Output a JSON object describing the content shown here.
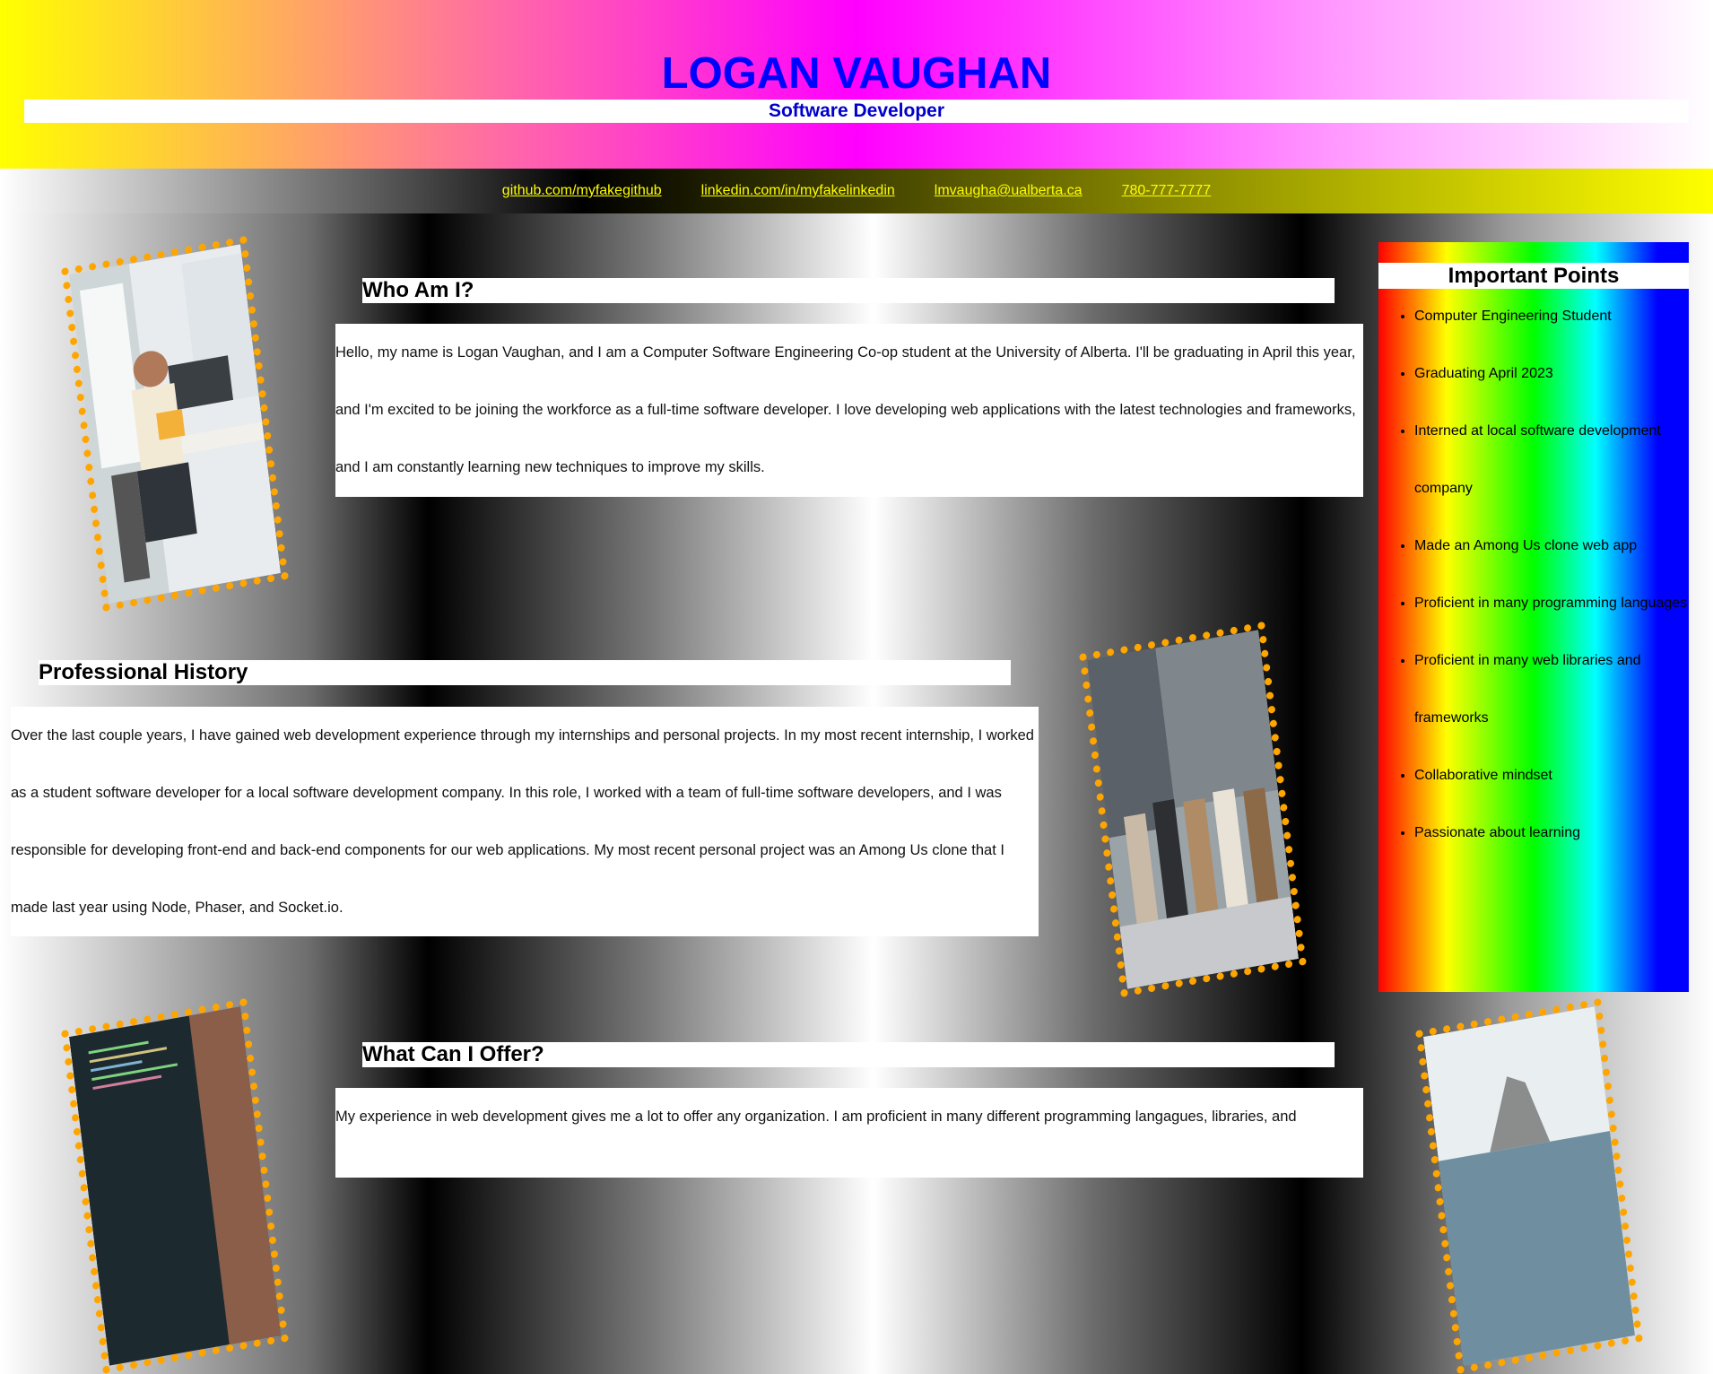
{
  "header": {
    "name": "LOGAN VAUGHAN",
    "title": "Software Developer"
  },
  "contact": {
    "links": [
      "github.com/myfakegithub",
      "linkedin.com/in/myfakelinkedin",
      "lmvaugha@ualberta.ca",
      "780-777-7777"
    ]
  },
  "sections": {
    "who": {
      "heading": "Who Am I?",
      "text": "Hello, my name is Logan Vaughan, and I am a Computer Software Engineering Co-op student at the University of Alberta. I'll be graduating in April this year, and I'm excited to be joining the workforce as a full-time software developer. I love developing web applications with the latest technologies and frameworks, and I am constantly learning new techniques to improve my skills."
    },
    "history": {
      "heading": "Professional History",
      "text": "Over the last couple years, I have gained web development experience through my internships and personal projects. In my most recent internship, I worked as a student software developer for a local software development company. In this role, I worked with a team of full-time software developers, and I was responsible for developing front-end and back-end components for our web applications. My most recent personal project was an Among Us clone that I made last year using Node, Phaser, and Socket.io."
    },
    "offer": {
      "heading": "What Can I Offer?",
      "text": "My experience in web development gives me a lot to offer any organization. I am proficient in many different programming langagues, libraries, and"
    }
  },
  "aside": {
    "title": "Important Points",
    "items": [
      "Computer Engineering Student",
      "Graduating April 2023",
      "Interned at local software development company",
      "Made an Among Us clone web app",
      "Proficient in many programming languages",
      "Proficient in many web libraries and frameworks",
      "Collaborative mindset",
      "Passionate about learning"
    ]
  },
  "colors": {
    "name": "#0000ff",
    "links": "#ffff00",
    "photo_border": "#ffa500"
  }
}
